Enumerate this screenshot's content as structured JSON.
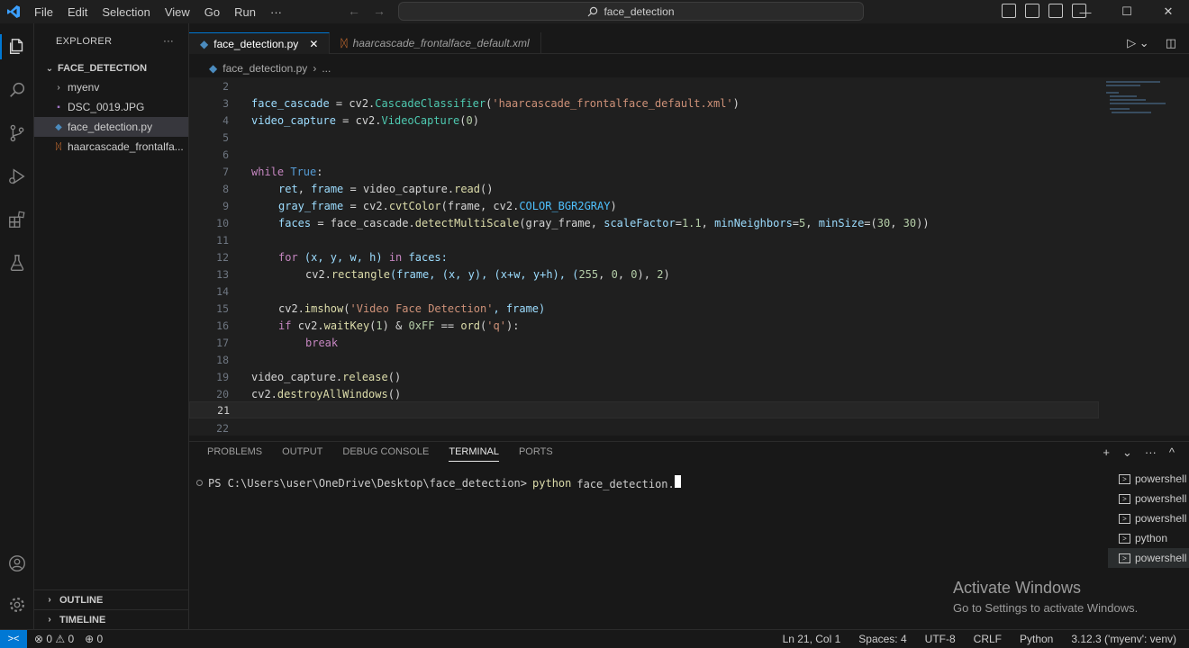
{
  "menu": [
    "File",
    "Edit",
    "Selection",
    "View",
    "Go",
    "Run",
    "···"
  ],
  "search": {
    "text": "face_detection"
  },
  "window_controls": [
    "—",
    "☐",
    "✕"
  ],
  "explorer": {
    "title": "EXPLORER",
    "more": "···",
    "folder": "FACE_DETECTION",
    "items": [
      "myenv",
      "DSC_0019.JPG",
      "face_detection.py",
      "haarcascade_frontalfa..."
    ],
    "outline": "OUTLINE",
    "timeline": "TIMELINE"
  },
  "tabs": [
    {
      "label": "face_detection.py",
      "close": "✕"
    },
    {
      "label": "haarcascade_frontalface_default.xml"
    }
  ],
  "breadcrumb": {
    "file": "face_detection.py",
    "more": "..."
  },
  "editor": {
    "line_numbers": [
      "2",
      "3",
      "4",
      "5",
      "6",
      "7",
      "8",
      "9",
      "10",
      "11",
      "12",
      "13",
      "14",
      "15",
      "16",
      "17",
      "18",
      "19",
      "20",
      "21",
      "22"
    ],
    "line3": {
      "a": "face_cascade ",
      "b": "= cv2.",
      "c": "CascadeClassifier",
      "d": "(",
      "e": "'haarcascade_frontalface_default.xml'",
      "f": ")"
    },
    "line4": {
      "a": "video_capture ",
      "b": "= cv2.",
      "c": "VideoCapture",
      "d": "(",
      "e": "0",
      "f": ")"
    },
    "line7": {
      "a": "while ",
      "b": "True",
      "c": ":"
    },
    "line8": {
      "a": "ret",
      "b": ", ",
      "c": "frame",
      "d": " = video_capture.",
      "e": "read",
      "f": "()"
    },
    "line9": {
      "a": "gray_frame",
      "b": " = cv2.",
      "c": "cvtColor",
      "d": "(frame, cv2.",
      "e": "COLOR_BGR2GRAY",
      "f": ")"
    },
    "line10": {
      "a": "faces",
      "b": " = face_cascade.",
      "c": "detectMultiScale",
      "d": "(gray_frame, ",
      "e": "scaleFactor",
      "f": "=",
      "g": "1.1",
      "h": ", ",
      "i": "minNeighbors",
      "j": "=",
      "k": "5",
      "l": ", ",
      "m": "minSize",
      "n": "=(",
      "o": "30",
      "p": ", ",
      "q": "30",
      "r": "))"
    },
    "line12": {
      "a": "for ",
      "b": "(x, y, w, h) ",
      "c": "in ",
      "d": "faces:"
    },
    "line13": {
      "a": "cv2.",
      "b": "rectangle",
      "c": "(frame, (x, y), (x+w, y+h), (",
      "d": "255",
      "e": ", ",
      "f": "0",
      "g": ", ",
      "h": "0",
      "i": "), ",
      "j": "2",
      "k": ")"
    },
    "line15": {
      "a": "cv2.",
      "b": "imshow",
      "c": "(",
      "d": "'Video Face Detection'",
      "e": ", frame)"
    },
    "line16": {
      "a": "if ",
      "b": "cv2.",
      "c": "waitKey",
      "d": "(",
      "e": "1",
      "f": ") & ",
      "g": "0xFF",
      "h": " == ",
      "i": "ord",
      "j": "(",
      "k": "'q'",
      "l": "):"
    },
    "line17": {
      "a": "break"
    },
    "line19": {
      "a": "video_capture.",
      "b": "release",
      "c": "()"
    },
    "line20": {
      "a": "cv2.",
      "b": "destroyAllWindows",
      "c": "()"
    }
  },
  "panel": {
    "tabs": [
      "PROBLEMS",
      "OUTPUT",
      "DEBUG CONSOLE",
      "TERMINAL",
      "PORTS"
    ],
    "actions": [
      "+",
      "⌄",
      "···",
      "^"
    ],
    "prompt": "PS C:\\Users\\user\\OneDrive\\Desktop\\face_detection>",
    "command": "python",
    "arg": "face_detection.",
    "terminals": [
      "powershell",
      "powershell",
      "powershell",
      "python",
      "powershell"
    ],
    "watermark_title": "Activate Windows",
    "watermark_sub": "Go to Settings to activate Windows."
  },
  "status": {
    "remote": "><",
    "errors": "⊗ 0 ⚠ 0",
    "ports": "⊕ 0",
    "position": "Ln 21, Col 1",
    "spaces": "Spaces: 4",
    "encoding": "UTF-8",
    "eol": "CRLF",
    "language": "Python",
    "interpreter": "3.12.3 ('myenv': venv)"
  }
}
